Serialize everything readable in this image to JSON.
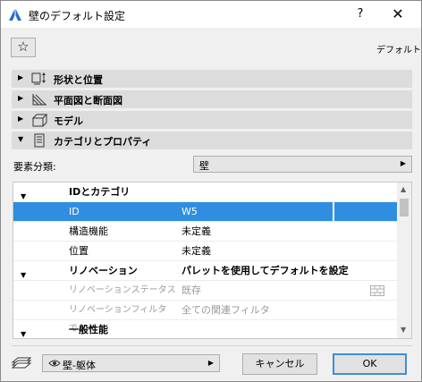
{
  "window": {
    "title": "壁のデフォルト設定",
    "help": "?",
    "close": "✕"
  },
  "toolbar": {
    "favorites_icon": "star-icon",
    "default_label": "デフォルト"
  },
  "sections": [
    {
      "label": "形状と位置",
      "icon": "geometry-icon",
      "expanded": false
    },
    {
      "label": "平面図と断面図",
      "icon": "floorplan-hatch-icon",
      "expanded": false
    },
    {
      "label": "モデル",
      "icon": "model-box-icon",
      "expanded": false
    },
    {
      "label": "カテゴリとプロパティ",
      "icon": "document-icon",
      "expanded": true
    }
  ],
  "classification": {
    "label": "要素分類:",
    "value": "壁"
  },
  "table": {
    "rows": [
      {
        "type": "group",
        "name": "IDとカテゴリ",
        "value": ""
      },
      {
        "type": "selected",
        "name": "ID",
        "value": "W5"
      },
      {
        "type": "item",
        "name": "構造機能",
        "value": "未定義"
      },
      {
        "type": "item",
        "name": "位置",
        "value": "未定義"
      },
      {
        "type": "group",
        "name": "リノベーション",
        "value": "パレットを使用してデフォルトを設定"
      },
      {
        "type": "dim",
        "name": "リノベーションステータス",
        "value": "既存"
      },
      {
        "type": "dim",
        "name": "リノベーションフィルタで...",
        "value": "全ての関連フィルタ"
      },
      {
        "type": "group",
        "name": "一般性能",
        "value": ""
      }
    ]
  },
  "footer": {
    "layer_value": "壁-躯体",
    "cancel_label": "キャンセル",
    "ok_label": "OK"
  },
  "colors": {
    "selection": "#2f8ee0",
    "section_header": "#dcdcdc",
    "ok_border": "#3c8fd8"
  }
}
